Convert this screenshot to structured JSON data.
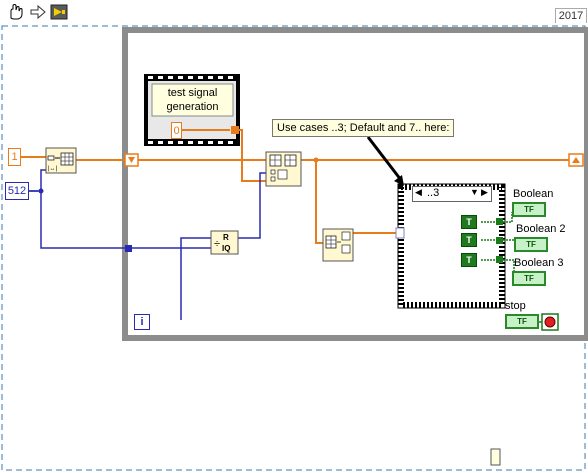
{
  "toolbar": {
    "version": "2017",
    "buttons": [
      {
        "name": "highlight-execution-icon"
      },
      {
        "name": "retain-wire-values-icon"
      },
      {
        "name": "step-into-icon"
      }
    ]
  },
  "constants": {
    "numeric_one": "1",
    "numeric_512": "512",
    "numeric_zero": "0",
    "iteration": "i"
  },
  "subvi": {
    "title_line1": "test signal",
    "title_line2": "generation"
  },
  "comment": "Use cases ..3; Default and 7.. here:",
  "case_selector": "..3",
  "indicators": {
    "boolean": "Boolean",
    "boolean2": "Boolean 2",
    "boolean3": "Boolean 3",
    "stop": "stop",
    "tf_text": "TF",
    "true_const": "T"
  },
  "colors": {
    "wire_numeric": "#e87c1a",
    "wire_int": "#2222aa",
    "wire_bool": "#1a7a1a",
    "loop_frame": "#909090"
  }
}
